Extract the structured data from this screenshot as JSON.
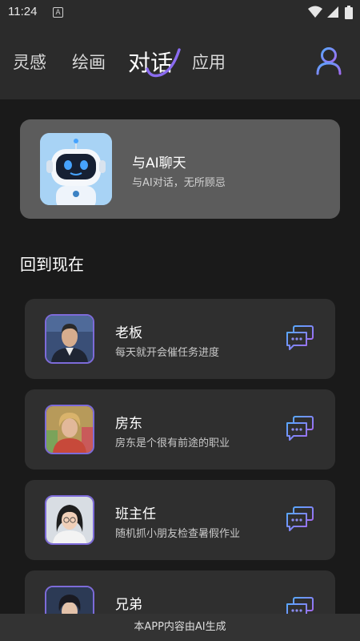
{
  "status_bar": {
    "time": "11:24",
    "notification_letter": "A"
  },
  "nav": {
    "tabs": [
      {
        "label": "灵感"
      },
      {
        "label": "绘画"
      },
      {
        "label": "对话",
        "active": true
      },
      {
        "label": "应用"
      }
    ],
    "accent_color": "#8b6cf0",
    "profile_icon": "user-icon"
  },
  "feature": {
    "title": "与AI聊天",
    "subtitle": "与AI对话，无所顾忌",
    "image": "robot-avatar"
  },
  "section": {
    "title": "回到现在"
  },
  "characters": [
    {
      "name": "老板",
      "desc": "每天就开会催任务进度"
    },
    {
      "name": "房东",
      "desc": "房东是个很有前途的职业"
    },
    {
      "name": "班主任",
      "desc": "随机抓小朋友检查暑假作业"
    },
    {
      "name": "兄弟",
      "desc": ""
    }
  ],
  "footer": {
    "text": "本APP内容由AI生成"
  }
}
